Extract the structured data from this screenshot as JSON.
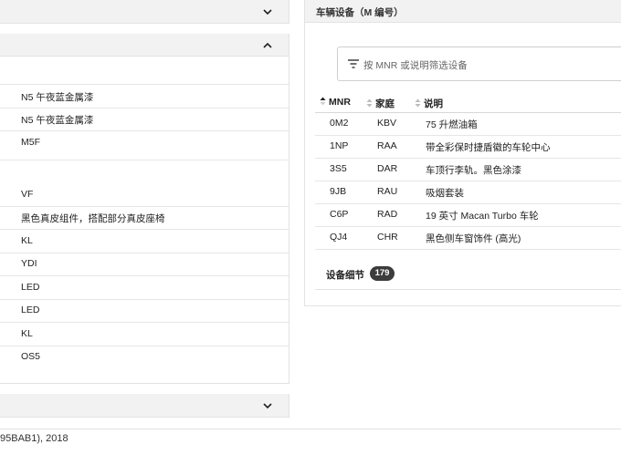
{
  "left_rows": [
    "",
    "N5 午夜蓝金属漆",
    "N5 午夜蓝金属漆",
    "M5F",
    "",
    "VF",
    "黑色真皮组件，搭配部分真皮座椅",
    "KL",
    "YDI",
    "LED",
    "LED",
    "KL",
    "OS5"
  ],
  "footer_text": "95BAB1), 2018",
  "right_panel": {
    "title": "车辆设备（M 编号）",
    "filter_placeholder": "按 MNR 或说明筛选设备",
    "columns": [
      "MNR",
      "家庭",
      "说明"
    ],
    "rows": [
      [
        "0M2",
        "KBV",
        "75 升燃油箱"
      ],
      [
        "1NP",
        "RAA",
        "带全彩保时捷盾徽的车轮中心"
      ],
      [
        "3S5",
        "DAR",
        "车顶行李轨。黑色涂漆"
      ],
      [
        "9JB",
        "RAU",
        "吸烟套装"
      ],
      [
        "C6P",
        "RAD",
        "19 英寸 Macan Turbo 车轮"
      ],
      [
        "QJ4",
        "CHR",
        "黑色侧车窗饰件 (高光)"
      ]
    ],
    "details_label": "设备细节",
    "details_count": "179"
  },
  "icons": {
    "collapse_top": "chevron-down-icon",
    "expand_section": "chevron-up-icon",
    "collapse_bottom": "chevron-down-icon",
    "filter": "filter-icon",
    "sort": "sort-icon"
  }
}
